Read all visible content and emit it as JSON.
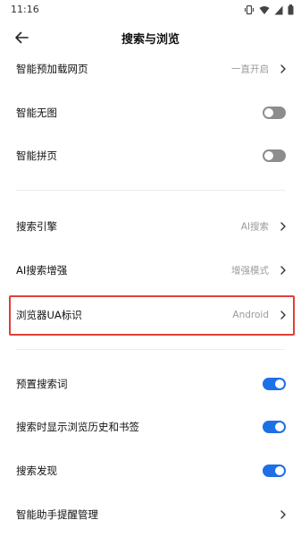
{
  "status_bar": {
    "time": "11:16"
  },
  "header": {
    "title": "搜索与浏览"
  },
  "colors": {
    "accent": "#1f6fe6",
    "toggle_off": "#8d8d8d",
    "highlight": "#e0403a"
  },
  "settings": {
    "smart_preload": {
      "label": "智能预加载网页",
      "value": "一直开启"
    },
    "smart_no_image": {
      "label": "智能无图",
      "enabled": false
    },
    "smart_page_join": {
      "label": "智能拼页",
      "enabled": false
    },
    "search_engine": {
      "label": "搜索引擎",
      "value": "AI搜索"
    },
    "ai_search_enhance": {
      "label": "AI搜索增强",
      "value": "增强模式"
    },
    "browser_ua": {
      "label": "浏览器UA标识",
      "value": "Android"
    },
    "preset_search_words": {
      "label": "预置搜索词",
      "enabled": true
    },
    "show_history_bookmarks": {
      "label": "搜索时显示浏览历史和书签",
      "enabled": true
    },
    "search_discovery": {
      "label": "搜索发现",
      "enabled": true
    },
    "assistant_reminders": {
      "label": "智能助手提醒管理"
    }
  }
}
